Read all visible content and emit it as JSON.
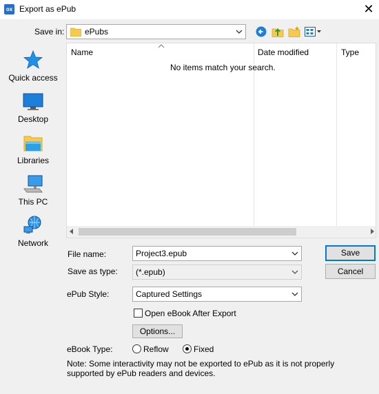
{
  "window": {
    "app_icon_text": "ox",
    "title": "Export as ePub",
    "close_glyph": "✕"
  },
  "save_in": {
    "label": "Save in:",
    "value": "ePubs"
  },
  "places": [
    {
      "label": "Quick access",
      "icon": "star-icon"
    },
    {
      "label": "Desktop",
      "icon": "desktop-icon"
    },
    {
      "label": "Libraries",
      "icon": "libraries-icon"
    },
    {
      "label": "This PC",
      "icon": "computer-icon"
    },
    {
      "label": "Network",
      "icon": "network-icon"
    }
  ],
  "file_list": {
    "columns": [
      "Name",
      "Date modified",
      "Type"
    ],
    "empty_message": "No items match your search."
  },
  "file_name": {
    "label": "File name:",
    "value": "Project3.epub"
  },
  "save_as_type": {
    "label": "Save as type:",
    "value": "(*.epub)"
  },
  "buttons": {
    "save": "Save",
    "cancel": "Cancel",
    "options": "Options..."
  },
  "epub_style": {
    "label": "ePub Style:",
    "value": "Captured Settings"
  },
  "open_after_export": {
    "label": "Open eBook After Export",
    "checked": false
  },
  "ebook_type": {
    "label": "eBook Type:",
    "options": [
      "Reflow",
      "Fixed"
    ],
    "selected": "Fixed"
  },
  "note": "Note: Some interactivity may not be exported to ePub as it is not properly supported by ePub readers and devices.",
  "colors": {
    "accent": "#0078d7",
    "folder": "#f6c94f",
    "nav_blue": "#1e7fd8"
  }
}
